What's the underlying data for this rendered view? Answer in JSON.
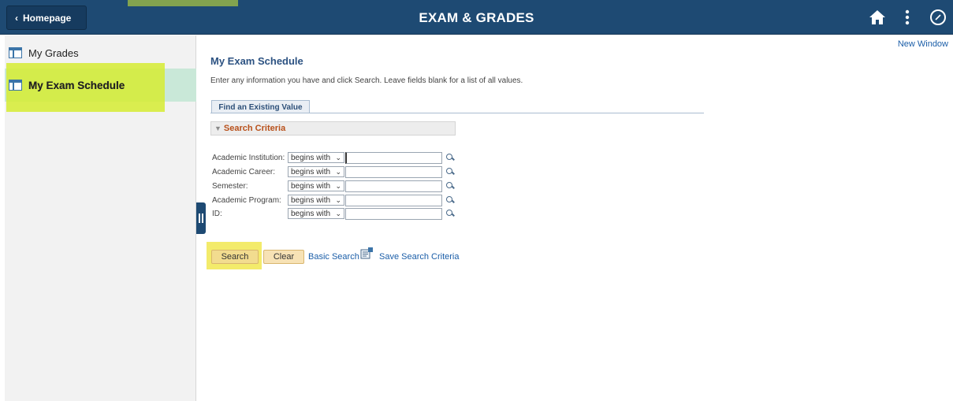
{
  "header": {
    "back_label": "Homepage",
    "title": "EXAM & GRADES",
    "icons": [
      "home-icon",
      "actions-menu-icon",
      "navbar-compass-icon"
    ],
    "bg_color": "#1e4a73"
  },
  "sidebar": {
    "items": [
      {
        "label": "My Grades",
        "selected": false
      },
      {
        "label": "My Exam Schedule",
        "selected": true
      }
    ],
    "selected_color": "#c9e8d8"
  },
  "main": {
    "new_window": "New Window",
    "title": "My Exam Schedule",
    "instructions": "Enter any information you have and click Search. Leave fields blank for a list of all values.",
    "tab_label": "Find an Existing Value",
    "criteria_label": "Search Criteria",
    "fields": [
      {
        "label": "Academic Institution:",
        "operator": "begins with",
        "value": ""
      },
      {
        "label": "Academic Career:",
        "operator": "begins with",
        "value": ""
      },
      {
        "label": "Semester:",
        "operator": "begins with",
        "value": ""
      },
      {
        "label": "Academic Program:",
        "operator": "begins with",
        "value": ""
      },
      {
        "label": "ID:",
        "operator": "begins with",
        "value": ""
      }
    ],
    "buttons": {
      "search": "Search",
      "clear": "Clear",
      "basic_search": "Basic Search",
      "save_search": "Save Search Criteria"
    },
    "highlight_color": "#d6ec32"
  }
}
